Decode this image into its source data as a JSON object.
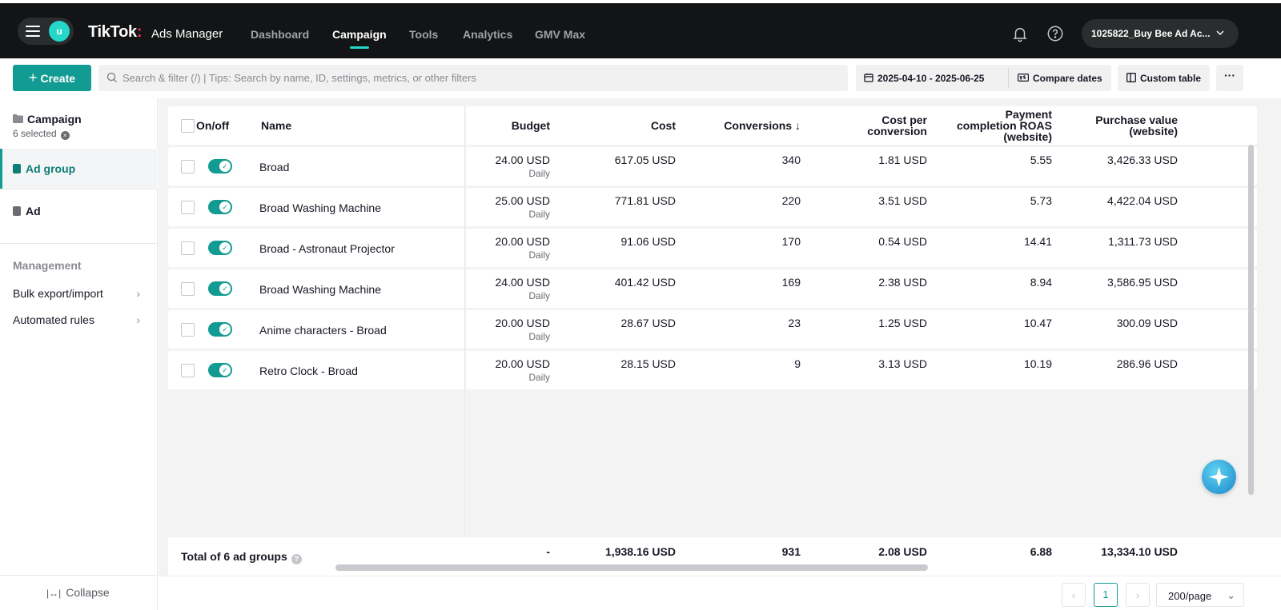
{
  "header": {
    "avatar_letter": "u",
    "brand": "TikTok",
    "brand_dot": ":",
    "brand_sub": "Ads Manager",
    "nav": [
      {
        "label": "Dashboard",
        "active": false
      },
      {
        "label": "Campaign",
        "active": true
      },
      {
        "label": "Tools",
        "active": false
      },
      {
        "label": "Analytics",
        "active": false
      },
      {
        "label": "GMV Max",
        "active": false
      }
    ],
    "account": "1025822_Buy Bee Ad Ac..."
  },
  "toolbar": {
    "create_label": "Create",
    "create_plus": "+",
    "search_placeholder": "Search & filter (/) | Tips: Search by name, ID, settings, metrics, or other filters",
    "date_range": "2025-04-10 - 2025-06-25",
    "compare_label": "Compare dates",
    "custom_table_label": "Custom table",
    "more_label": "···"
  },
  "sidebar": {
    "campaign_label": "Campaign",
    "campaign_selected": "6 selected",
    "campaign_clear": "×",
    "items": [
      {
        "label": "Ad group",
        "active": true
      },
      {
        "label": "Ad",
        "active": false
      }
    ],
    "management_heading": "Management",
    "links": [
      {
        "label": "Bulk export/import"
      },
      {
        "label": "Automated rules"
      }
    ],
    "chevron": "›",
    "collapse_icon": "|↔|",
    "collapse_label": "Collapse"
  },
  "table": {
    "headers": {
      "onoff": "On/off",
      "name": "Name",
      "budget": "Budget",
      "cost": "Cost",
      "conversions": "Conversions ↓",
      "cpc": [
        "Cost per",
        "conversion"
      ],
      "roas": [
        "Payment",
        "completion ROAS",
        "(website)"
      ],
      "purchase": [
        "Purchase value",
        "(website)"
      ]
    },
    "rows": [
      {
        "name": "Broad",
        "budget": "24.00 USD",
        "budget_type": "Daily",
        "cost": "617.05 USD",
        "conversions": "340",
        "cpc": "1.81 USD",
        "roas": "5.55",
        "purchase": "3,426.33 USD"
      },
      {
        "name": "Broad Washing Machine",
        "budget": "25.00 USD",
        "budget_type": "Daily",
        "cost": "771.81 USD",
        "conversions": "220",
        "cpc": "3.51 USD",
        "roas": "5.73",
        "purchase": "4,422.04 USD"
      },
      {
        "name": "Broad - Astronaut Projector",
        "budget": "20.00 USD",
        "budget_type": "Daily",
        "cost": "91.06 USD",
        "conversions": "170",
        "cpc": "0.54 USD",
        "roas": "14.41",
        "purchase": "1,311.73 USD"
      },
      {
        "name": "Broad Washing Machine",
        "budget": "24.00 USD",
        "budget_type": "Daily",
        "cost": "401.42 USD",
        "conversions": "169",
        "cpc": "2.38 USD",
        "roas": "8.94",
        "purchase": "3,586.95 USD"
      },
      {
        "name": "Anime characters - Broad",
        "budget": "20.00 USD",
        "budget_type": "Daily",
        "cost": "28.67 USD",
        "conversions": "23",
        "cpc": "1.25 USD",
        "roas": "10.47",
        "purchase": "300.09 USD"
      },
      {
        "name": "Retro Clock - Broad",
        "budget": "20.00 USD",
        "budget_type": "Daily",
        "cost": "28.15 USD",
        "conversions": "9",
        "cpc": "3.13 USD",
        "roas": "10.19",
        "purchase": "286.96 USD"
      }
    ],
    "total": {
      "label": "Total of 6 ad groups",
      "help": "?",
      "budget": "-",
      "cost": "1,938.16 USD",
      "conversions": "931",
      "cpc": "2.08 USD",
      "roas": "6.88",
      "purchase": "13,334.10 USD"
    }
  },
  "pagination": {
    "prev": "‹",
    "current_page": "1",
    "next": "›",
    "page_size": "200/page",
    "size_chevron": "⌄"
  },
  "colors": {
    "accent": "#129b92",
    "topbar": "#121415",
    "brand_dot": "#fe2c55"
  }
}
